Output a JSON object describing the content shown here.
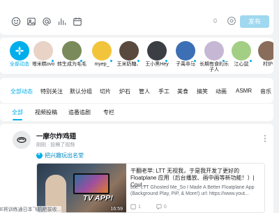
{
  "composer": {
    "char_count": "0",
    "publish_label": "发布",
    "tools": [
      "emoji-icon",
      "image-icon",
      "at-icon",
      "poll-icon",
      "schedule-icon"
    ]
  },
  "ups": [
    {
      "name": "全部动态",
      "active": true
    },
    {
      "name": "塔米糕ovo",
      "color": "#e9d3c6"
    },
    {
      "name": "转生成为毛毛",
      "color": "#7a8a5a"
    },
    {
      "name": "myep_",
      "color": "#f2c43b"
    },
    {
      "name": "王米奶糖、",
      "color": "#5a4a3e"
    },
    {
      "name": "王小黑Hey",
      "color": "#3b3f44"
    },
    {
      "name": "子禹非马",
      "color": "#3d6fb4"
    },
    {
      "name": "长期有食的乐子人",
      "color": "#c6b8d4"
    },
    {
      "name": "江心鼠",
      "color": "#a3cf84"
    },
    {
      "name": "村炉",
      "color": "#8a6c5a"
    }
  ],
  "categories": [
    "全部动态",
    "特别关注",
    "默认分组",
    "切片",
    "炉石",
    "管人",
    "手工",
    "美食",
    "搞笑",
    "动画",
    "ASMR",
    "音乐"
  ],
  "type_tabs": [
    "全部",
    "视频投稿",
    "追番追剧",
    "专栏"
  ],
  "post": {
    "author": "一摩尔炸鸡翅",
    "meta": "刚刚 · 投稿了视频",
    "topic": "把兴趣玩出名堂",
    "video": {
      "duration": "16:59",
      "thumb_text": "TV APP!",
      "title": "干翻老苹: LTT 无视我，于是我开发了更好的 Floatplane 应用（后台播放、画中画等新功能！）| Coul...",
      "desc": "title: LTT Ghosted Me_So I Made A Better Floatplane App (Background Play, PiP, & More!) url: https://www.yout...",
      "likes": "1",
      "comments": "0"
    }
  },
  "overlay": "E将训练通日本飞机吧拔收..."
}
